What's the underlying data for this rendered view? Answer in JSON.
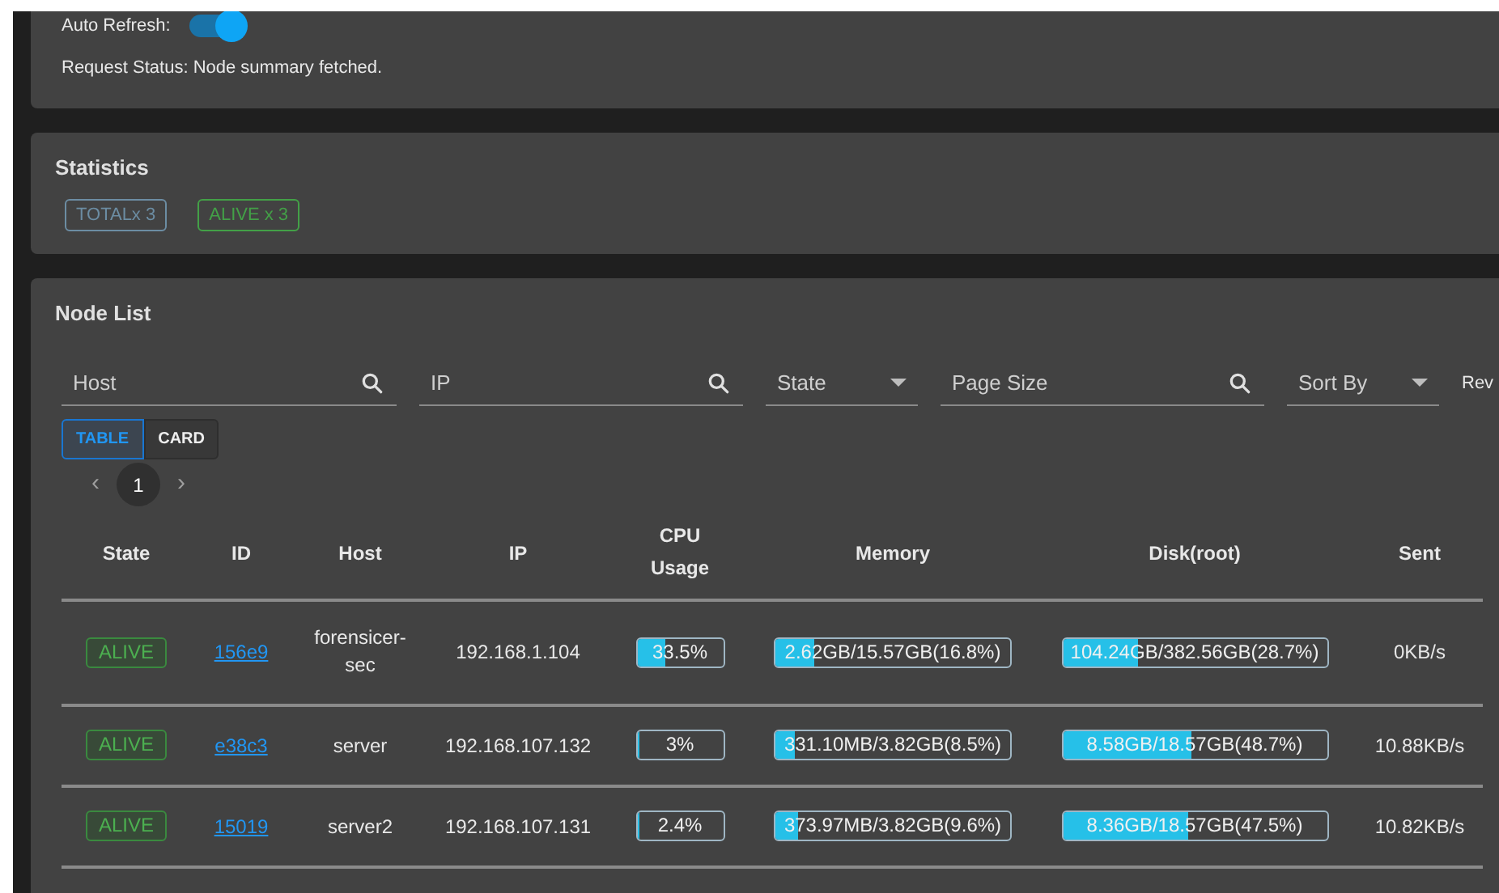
{
  "auto_refresh": {
    "label": "Auto Refresh:",
    "on": true
  },
  "request_status": "Request Status: Node summary fetched.",
  "statistics": {
    "title": "Statistics",
    "chips": [
      {
        "label": "TOTALx 3",
        "color": "#6c8da3"
      },
      {
        "label": "ALIVE x 3",
        "color": "#43a047"
      }
    ]
  },
  "node_list": {
    "title": "Node List",
    "filters": [
      {
        "kind": "search",
        "placeholder": "Host"
      },
      {
        "kind": "search",
        "placeholder": "IP"
      },
      {
        "kind": "select",
        "placeholder": "State"
      },
      {
        "kind": "search",
        "placeholder": "Page Size"
      },
      {
        "kind": "select",
        "placeholder": "Sort By"
      }
    ],
    "filter_cut_label": "Rev",
    "view_toggle": [
      {
        "label": "TABLE",
        "selected": true
      },
      {
        "label": "CARD",
        "selected": false
      }
    ],
    "pagination": {
      "prev": "‹",
      "pages": [
        {
          "label": "1",
          "selected": true
        }
      ],
      "next": "›"
    },
    "table": {
      "columns": [
        "State",
        "ID",
        "Host",
        "IP",
        "CPU Usage",
        "Memory",
        "Disk(root)",
        "Sent"
      ],
      "rows": [
        {
          "state": "ALIVE",
          "id": "156e9",
          "host": "forensicer-sec",
          "ip": "192.168.1.104",
          "cpu": {
            "text": "33.5%",
            "level": 0.335
          },
          "memory": {
            "text": "2.62GB/15.57GB(16.8%)",
            "level": 0.168
          },
          "disk": {
            "text": "104.24GB/382.56GB(28.7%)",
            "level": 0.287
          },
          "sent": "0KB/s"
        },
        {
          "state": "ALIVE",
          "id": "e38c3",
          "host": "server",
          "ip": "192.168.107.132",
          "cpu": {
            "text": "3%",
            "level": 0.03
          },
          "memory": {
            "text": "331.10MB/3.82GB(8.5%)",
            "level": 0.085
          },
          "disk": {
            "text": "8.58GB/18.57GB(48.7%)",
            "level": 0.487
          },
          "sent": "10.88KB/s"
        },
        {
          "state": "ALIVE",
          "id": "15019",
          "host": "server2",
          "ip": "192.168.107.131",
          "cpu": {
            "text": "2.4%",
            "level": 0.024
          },
          "memory": {
            "text": "373.97MB/3.82GB(9.6%)",
            "level": 0.096
          },
          "disk": {
            "text": "8.36GB/18.57GB(47.5%)",
            "level": 0.475
          },
          "sent": "10.82KB/s"
        }
      ]
    }
  }
}
